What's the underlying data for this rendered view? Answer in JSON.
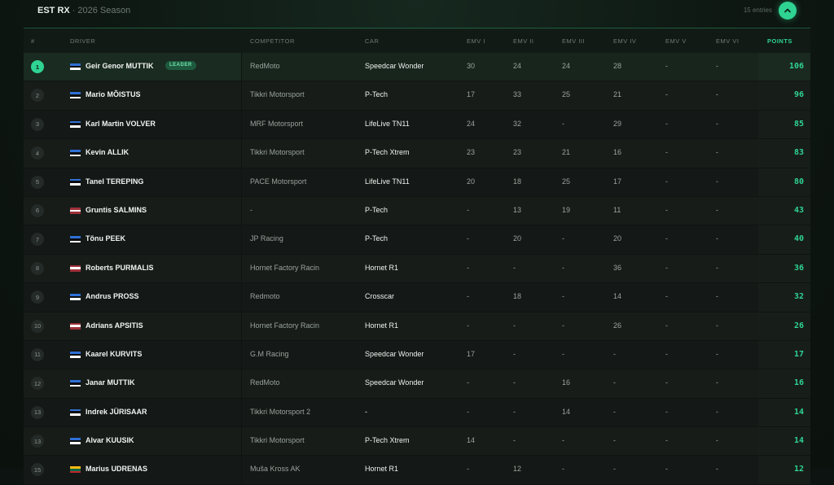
{
  "header": {
    "series": "EST RX",
    "separator": "·",
    "season": "2026 Season",
    "entries": "15 entries"
  },
  "colors": {
    "accent": "#2fd392",
    "flag_estonia": [
      "#2f6fd6",
      "#0b0b0b",
      "#ffffff"
    ],
    "flag_latvia": [
      "#9e3039",
      "#ffffff",
      "#9e3039"
    ],
    "flag_lithuania": [
      "#fdb913",
      "#006a44",
      "#c1272d"
    ]
  },
  "icons": {
    "collapse": "chevron-up-icon"
  },
  "columns": {
    "pos": "#",
    "driver": "DRIVER",
    "competitor": "COMPETITOR",
    "car": "CAR",
    "r1": "EMV I",
    "r2": "EMV II",
    "r3": "EMV III",
    "r4": "EMV IV",
    "r5": "EMV V",
    "r6": "EMV VI",
    "points": "POINTS"
  },
  "leader_badge": "LEADER",
  "rows": [
    {
      "pos": "1",
      "flag": "EST",
      "driver": "Geir Genor MUTTIK",
      "competitor": "RedMoto",
      "car": "Speedcar Wonder",
      "r": [
        "30",
        "24",
        "24",
        "28",
        "-",
        "-"
      ],
      "points": "106"
    },
    {
      "pos": "2",
      "flag": "EST",
      "driver": "Mario MÕISTUS",
      "competitor": "Tikkri Motorsport",
      "car": "P-Tech",
      "r": [
        "17",
        "33",
        "25",
        "21",
        "-",
        "-"
      ],
      "points": "96"
    },
    {
      "pos": "3",
      "flag": "EST",
      "driver": "Karl Martin VOLVER",
      "competitor": "MRF Motorsport",
      "car": "LifeLive TN11",
      "r": [
        "24",
        "32",
        "-",
        "29",
        "-",
        "-"
      ],
      "points": "85"
    },
    {
      "pos": "4",
      "flag": "EST",
      "driver": "Kevin ALLIK",
      "competitor": "Tikkri Motorsport",
      "car": "P-Tech Xtrem",
      "r": [
        "23",
        "23",
        "21",
        "16",
        "-",
        "-"
      ],
      "points": "83"
    },
    {
      "pos": "5",
      "flag": "EST",
      "driver": "Tanel TEREPING",
      "competitor": "PACE Motorsport",
      "car": "LifeLive TN11",
      "r": [
        "20",
        "18",
        "25",
        "17",
        "-",
        "-"
      ],
      "points": "80"
    },
    {
      "pos": "6",
      "flag": "LAT",
      "driver": "Gruntis SALMINS",
      "competitor": "-",
      "car": "P-Tech",
      "r": [
        "-",
        "13",
        "19",
        "11",
        "-",
        "-"
      ],
      "points": "43"
    },
    {
      "pos": "7",
      "flag": "EST",
      "driver": "Tõnu PEEK",
      "competitor": "JP Racing",
      "car": "P-Tech",
      "r": [
        "-",
        "20",
        "-",
        "20",
        "-",
        "-"
      ],
      "points": "40"
    },
    {
      "pos": "8",
      "flag": "LAT",
      "driver": "Roberts PURMALIS",
      "competitor": "Hornet Factory Racin",
      "car": "Hornet R1",
      "r": [
        "-",
        "-",
        "-",
        "36",
        "-",
        "-"
      ],
      "points": "36"
    },
    {
      "pos": "9",
      "flag": "EST",
      "driver": "Andrus PROSS",
      "competitor": "Redmoto",
      "car": "Crosscar",
      "r": [
        "-",
        "18",
        "-",
        "14",
        "-",
        "-"
      ],
      "points": "32"
    },
    {
      "pos": "10",
      "flag": "LAT",
      "driver": "Adrians APSITIS",
      "competitor": "Hornet Factory Racin",
      "car": "Hornet R1",
      "r": [
        "-",
        "-",
        "-",
        "26",
        "-",
        "-"
      ],
      "points": "26"
    },
    {
      "pos": "11",
      "flag": "EST",
      "driver": "Kaarel KURVITS",
      "competitor": "G.M Racing",
      "car": "Speedcar Wonder",
      "r": [
        "17",
        "-",
        "-",
        "-",
        "-",
        "-"
      ],
      "points": "17"
    },
    {
      "pos": "12",
      "flag": "EST",
      "driver": "Janar MUTTIK",
      "competitor": "RedMoto",
      "car": "Speedcar Wonder",
      "r": [
        "-",
        "-",
        "16",
        "-",
        "-",
        "-"
      ],
      "points": "16"
    },
    {
      "pos": "13",
      "flag": "EST",
      "driver": "Indrek JÜRISAAR",
      "competitor": "Tikkri Motorsport 2",
      "car": "-",
      "r": [
        "-",
        "-",
        "14",
        "-",
        "-",
        "-"
      ],
      "points": "14"
    },
    {
      "pos": "13",
      "flag": "EST",
      "driver": "Alvar KUUSIK",
      "competitor": "Tikkri Motorsport",
      "car": "P-Tech Xtrem",
      "r": [
        "14",
        "-",
        "-",
        "-",
        "-",
        "-"
      ],
      "points": "14"
    },
    {
      "pos": "15",
      "flag": "LTU",
      "driver": "Marius UDRENAS",
      "competitor": "Muša Kross AK",
      "car": "Hornet R1",
      "r": [
        "-",
        "12",
        "-",
        "-",
        "-",
        "-"
      ],
      "points": "12"
    }
  ]
}
